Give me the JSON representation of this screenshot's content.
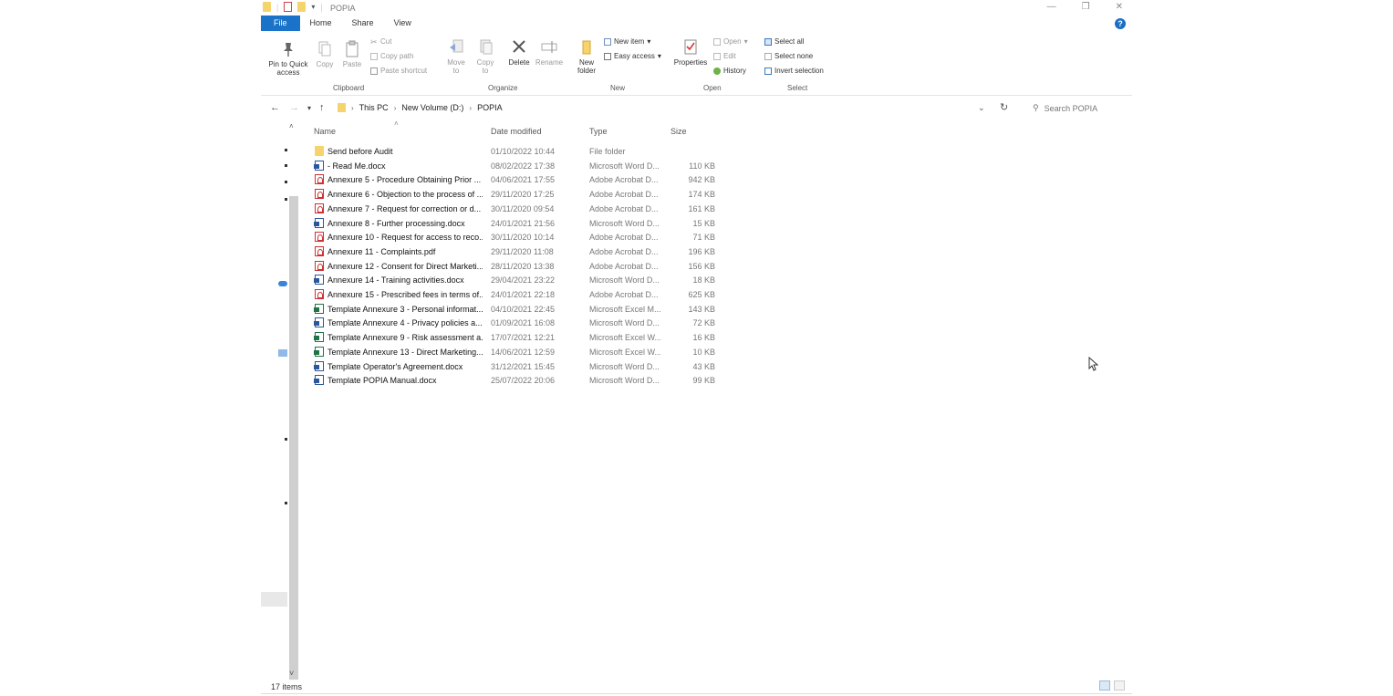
{
  "window": {
    "title": "POPIA",
    "controls": [
      "minimize-icon",
      "restore-icon",
      "close-icon"
    ]
  },
  "ribbon_tabs": [
    {
      "label": "File"
    },
    {
      "label": "Home"
    },
    {
      "label": "Share"
    },
    {
      "label": "View"
    }
  ],
  "ribbon": {
    "clipboard": {
      "pin_label": "Pin to Quick access",
      "copy_label": "Copy",
      "paste_label": "Paste",
      "cut_label": "Cut",
      "copy_path_label": "Copy path",
      "paste_shortcut_label": "Paste shortcut",
      "group_label": "Clipboard"
    },
    "organize": {
      "move_to_label": "Move to",
      "copy_to_label": "Copy to",
      "delete_label": "Delete",
      "rename_label": "Rename",
      "group_label": "Organize"
    },
    "new": {
      "new_folder_label": "New folder",
      "new_item_label": "New item",
      "easy_access_label": "Easy access",
      "group_label": "New"
    },
    "open": {
      "properties_label": "Properties",
      "open_label": "Open",
      "edit_label": "Edit",
      "history_label": "History",
      "group_label": "Open"
    },
    "select": {
      "select_all_label": "Select all",
      "select_none_label": "Select none",
      "invert_label": "Invert selection",
      "group_label": "Select"
    }
  },
  "address": {
    "crumbs": [
      "This PC",
      "New Volume (D:)",
      "POPIA"
    ],
    "search_placeholder": "Search POPIA"
  },
  "columns": {
    "name": "Name",
    "date": "Date modified",
    "type": "Type",
    "size": "Size"
  },
  "files": [
    {
      "kind": "folder",
      "name": "Send before Audit",
      "date": "01/10/2022 10:44",
      "type": "File folder",
      "size": ""
    },
    {
      "kind": "word",
      "name": "- Read Me.docx",
      "date": "08/02/2022 17:38",
      "type": "Microsoft Word D...",
      "size": "110 KB"
    },
    {
      "kind": "pdf",
      "name": "Annexure 5 - Procedure Obtaining Prior ...",
      "date": "04/06/2021 17:55",
      "type": "Adobe Acrobat D...",
      "size": "942 KB"
    },
    {
      "kind": "pdf",
      "name": "Annexure 6 - Objection to the process of ...",
      "date": "29/11/2020 17:25",
      "type": "Adobe Acrobat D...",
      "size": "174 KB"
    },
    {
      "kind": "pdf",
      "name": "Annexure 7 - Request for correction or d...",
      "date": "30/11/2020 09:54",
      "type": "Adobe Acrobat D...",
      "size": "161 KB"
    },
    {
      "kind": "word",
      "name": "Annexure 8 - Further processing.docx",
      "date": "24/01/2021 21:56",
      "type": "Microsoft Word D...",
      "size": "15 KB"
    },
    {
      "kind": "pdf",
      "name": "Annexure 10 - Request for access to reco...",
      "date": "30/11/2020 10:14",
      "type": "Adobe Acrobat D...",
      "size": "71 KB"
    },
    {
      "kind": "pdf",
      "name": "Annexure 11 - Complaints.pdf",
      "date": "29/11/2020 11:08",
      "type": "Adobe Acrobat D...",
      "size": "196 KB"
    },
    {
      "kind": "pdf",
      "name": "Annexure 12 - Consent for Direct Marketi...",
      "date": "28/11/2020 13:38",
      "type": "Adobe Acrobat D...",
      "size": "156 KB"
    },
    {
      "kind": "word",
      "name": "Annexure 14 - Training activities.docx",
      "date": "29/04/2021 23:22",
      "type": "Microsoft Word D...",
      "size": "18 KB"
    },
    {
      "kind": "pdf",
      "name": "Annexure 15 - Prescribed fees in terms of...",
      "date": "24/01/2021 22:18",
      "type": "Adobe Acrobat D...",
      "size": "625 KB"
    },
    {
      "kind": "excel",
      "name": "Template Annexure 3 - Personal informat...",
      "date": "04/10/2021 22:45",
      "type": "Microsoft Excel M...",
      "size": "143 KB"
    },
    {
      "kind": "word",
      "name": "Template Annexure 4 - Privacy policies a...",
      "date": "01/09/2021 16:08",
      "type": "Microsoft Word D...",
      "size": "72 KB"
    },
    {
      "kind": "excel",
      "name": "Template Annexure 9 - Risk assessment a...",
      "date": "17/07/2021 12:21",
      "type": "Microsoft Excel W...",
      "size": "16 KB"
    },
    {
      "kind": "excel",
      "name": "Template Annexure 13 - Direct Marketing...",
      "date": "14/06/2021 12:59",
      "type": "Microsoft Excel W...",
      "size": "10 KB"
    },
    {
      "kind": "word",
      "name": "Template Operator's Agreement.docx",
      "date": "31/12/2021 15:45",
      "type": "Microsoft Word D...",
      "size": "43 KB"
    },
    {
      "kind": "word",
      "name": "Template POPIA Manual.docx",
      "date": "25/07/2022 20:06",
      "type": "Microsoft Word D...",
      "size": "99 KB"
    }
  ],
  "status": {
    "item_count": "17 items"
  },
  "colors": {
    "file_tab": "#1a73c8",
    "folder": "#f6d36d",
    "word": "#2b579a",
    "pdf": "#d03030",
    "excel": "#217346"
  }
}
